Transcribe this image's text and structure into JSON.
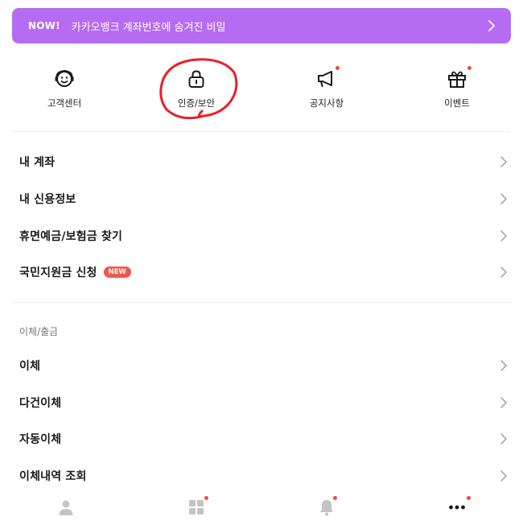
{
  "banner": {
    "badge": "NOW!",
    "text": "카카오뱅크 계좌번호에 숨겨진 비밀"
  },
  "quick_menu": [
    {
      "label": "고객센터",
      "icon": "headset-smile-icon",
      "has_dot": false
    },
    {
      "label": "인증/보안",
      "icon": "lock-icon",
      "has_dot": false
    },
    {
      "label": "공지사항",
      "icon": "megaphone-icon",
      "has_dot": true
    },
    {
      "label": "이벤트",
      "icon": "gift-icon",
      "has_dot": true
    }
  ],
  "menu_account": [
    {
      "label": "내 계좌"
    },
    {
      "label": "내 신용정보"
    },
    {
      "label": "휴면예금/보험금 찾기"
    },
    {
      "label": "국민지원금 신청",
      "badge": "NEW"
    }
  ],
  "transfer_section": {
    "title": "이체/출금",
    "items": [
      {
        "label": "이체"
      },
      {
        "label": "다건이체"
      },
      {
        "label": "자동이체"
      },
      {
        "label": "이체내역 조회"
      }
    ]
  },
  "tabbar": [
    {
      "icon": "person-icon",
      "has_dot": false
    },
    {
      "icon": "grid-icon",
      "has_dot": true
    },
    {
      "icon": "bell-icon",
      "has_dot": true
    },
    {
      "icon": "more-dots-icon",
      "has_dot": true,
      "active": true
    }
  ],
  "colors": {
    "banner": "#b56cf2",
    "notification_dot": "#ef4b3f",
    "annotation_circle": "#e8202a"
  }
}
